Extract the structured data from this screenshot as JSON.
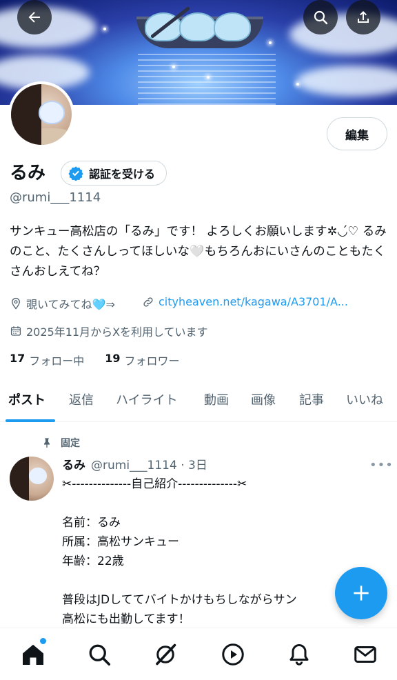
{
  "header": {
    "back_icon": "arrow-left-icon",
    "search_icon": "search-icon",
    "share_icon": "share-icon"
  },
  "profile": {
    "edit_label": "編集",
    "name": "るみ",
    "verify_label": "認証を受ける",
    "handle": "@rumi___1114",
    "bio": "サンキュー高松店の「るみ」です！ よろしくお願いします✲◡́♡ るみのこと、たくさんしってほしいな🤍もちろんおにいさんのこともたくさんおしえてね？",
    "location": "覗いてみてね🩵⇒",
    "link": "cityheaven.net/kagawa/A3701/A...",
    "joined": "2025年11月からXを利用しています",
    "following_count": "17",
    "following_label": "フォロー中",
    "followers_count": "19",
    "followers_label": "フォロワー"
  },
  "tabs": [
    {
      "label": "ポスト"
    },
    {
      "label": "返信"
    },
    {
      "label": "ハイライト"
    },
    {
      "label": "動画"
    },
    {
      "label": "画像"
    },
    {
      "label": "記事"
    },
    {
      "label": "いいね"
    }
  ],
  "post": {
    "pinned_label": "固定",
    "name": "るみ",
    "meta": "@rumi___1114 · 3日",
    "more": "•••",
    "body": "✂--------------自己紹介--------------✂\n\n名前：るみ\n所属：高松サンキュー\n年齢：22歳\n\n普段はJDしててバイトかけもちしながらサン\n高松にも出勤してます！"
  },
  "fab": {
    "icon": "plus-icon"
  },
  "nav": [
    {
      "icon": "home-icon"
    },
    {
      "icon": "search-icon"
    },
    {
      "icon": "grok-icon"
    },
    {
      "icon": "play-icon"
    },
    {
      "icon": "bell-icon"
    },
    {
      "icon": "mail-icon"
    }
  ],
  "colors": {
    "accent": "#1d9bf0",
    "text": "#0f1419",
    "muted": "#536471"
  }
}
